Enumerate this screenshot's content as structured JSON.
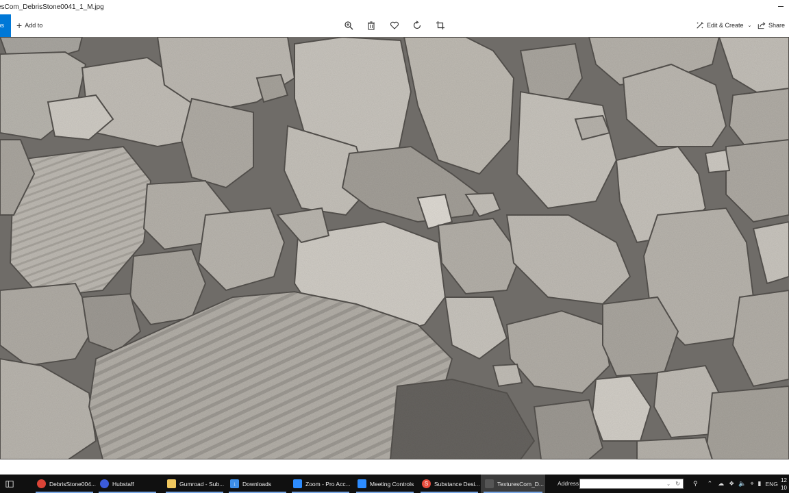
{
  "window": {
    "title": "esCom_DebrisStone0041_1_M.jpg"
  },
  "toolbar": {
    "photos_label": "tos",
    "add_to_label": "Add to",
    "edit_create_label": "Edit & Create",
    "share_label": "Share",
    "icons": [
      "zoom-icon",
      "delete-icon",
      "favorite-icon",
      "rotate-icon",
      "crop-icon"
    ]
  },
  "colors": {
    "accent": "#0078d7",
    "taskbar": "#101010"
  },
  "taskbar": {
    "items": [
      {
        "label": "DebrisStone004...",
        "icon": "chrome-icon",
        "color": "#db4437"
      },
      {
        "label": "Hubstaff",
        "icon": "hubstaff-icon",
        "color": "#3b5bdb"
      },
      {
        "label": "Gumroad - Sub...",
        "icon": "file-explorer-icon",
        "color": "#f0c75e"
      },
      {
        "label": "Downloads",
        "icon": "downloads-icon",
        "color": "#3d8ee8"
      },
      {
        "label": "Zoom - Pro Acc...",
        "icon": "zoom-app-icon",
        "color": "#2d8cff"
      },
      {
        "label": "Meeting Controls",
        "icon": "zoom-app-icon",
        "color": "#2d8cff"
      },
      {
        "label": "Substance Desi...",
        "icon": "substance-icon",
        "color": "#e84c3d"
      },
      {
        "label": "TexturesCom_D...",
        "icon": "photos-icon",
        "color": "#555555"
      }
    ],
    "address_label": "Address",
    "language": "ENG",
    "clock_top": "12",
    "clock_bottom": "10"
  }
}
